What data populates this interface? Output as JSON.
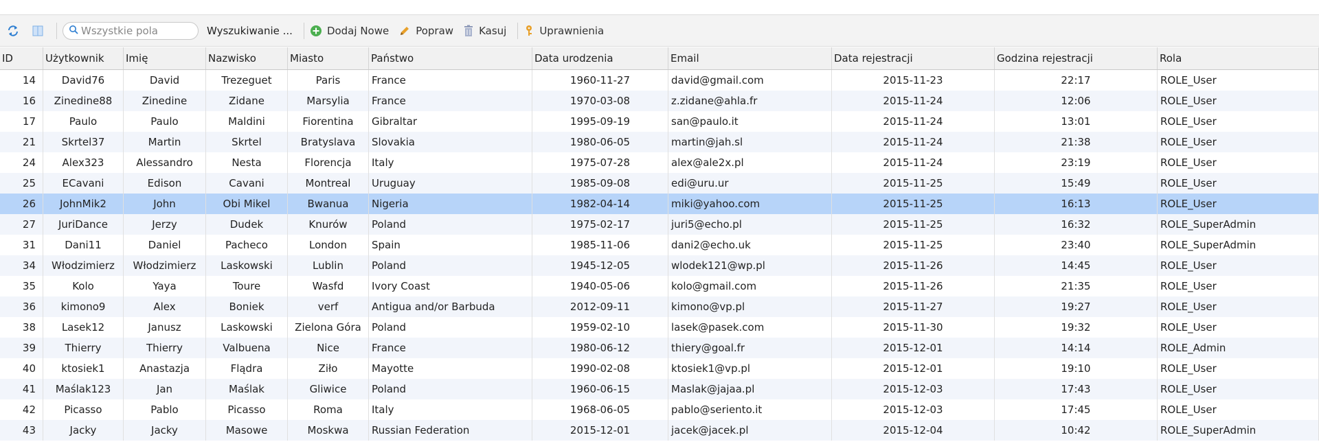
{
  "toolbar": {
    "search_placeholder": "Wszystkie pola",
    "advanced_search": "Wyszukiwanie ...",
    "add_new": "Dodaj Nowe",
    "edit": "Popraw",
    "delete": "Kasuj",
    "permissions": "Uprawnienia"
  },
  "colors": {
    "selected_row": "#b7d4f9",
    "alt_row": "#f2f5fb",
    "add_icon": "#4caf50",
    "edit_icon": "#e8a02a",
    "delete_icon": "#8e9ab8",
    "permissions_icon": "#e8a02a"
  },
  "table": {
    "columns": [
      "ID",
      "Użytkownik",
      "Imię",
      "Nazwisko",
      "Miasto",
      "Państwo",
      "Data urodzenia",
      "Email",
      "Data rejestracji",
      "Godzina rejestracji",
      "Rola"
    ],
    "selected_id": "26",
    "rows": [
      [
        "14",
        "David76",
        "David",
        "Trezeguet",
        "Paris",
        "France",
        "1960-11-27",
        "david@gmail.com",
        "2015-11-23",
        "22:17",
        "ROLE_User"
      ],
      [
        "16",
        "Zinedine88",
        "Zinedine",
        "Zidane",
        "Marsylia",
        "France",
        "1970-03-08",
        "z.zidane@ahla.fr",
        "2015-11-24",
        "12:06",
        "ROLE_User"
      ],
      [
        "17",
        "Paulo",
        "Paulo",
        "Maldini",
        "Fiorentina",
        "Gibraltar",
        "1995-09-19",
        "san@paulo.it",
        "2015-11-24",
        "13:01",
        "ROLE_User"
      ],
      [
        "21",
        "Skrtel37",
        "Martin",
        "Skrtel",
        "Bratyslava",
        "Slovakia",
        "1980-06-05",
        "martin@jah.sl",
        "2015-11-24",
        "21:38",
        "ROLE_User"
      ],
      [
        "24",
        "Alex323",
        "Alessandro",
        "Nesta",
        "Florencja",
        "Italy",
        "1975-07-28",
        "alex@ale2x.pl",
        "2015-11-24",
        "23:19",
        "ROLE_User"
      ],
      [
        "25",
        "ECavani",
        "Edison",
        "Cavani",
        "Montreal",
        "Uruguay",
        "1985-09-08",
        "edi@uru.ur",
        "2015-11-25",
        "15:49",
        "ROLE_User"
      ],
      [
        "26",
        "JohnMik2",
        "John",
        "Obi Mikel",
        "Bwanua",
        "Nigeria",
        "1982-04-14",
        "miki@yahoo.com",
        "2015-11-25",
        "16:13",
        "ROLE_User"
      ],
      [
        "27",
        "JuriDance",
        "Jerzy",
        "Dudek",
        "Knurów",
        "Poland",
        "1975-02-17",
        "juri5@echo.pl",
        "2015-11-25",
        "16:32",
        "ROLE_SuperAdmin"
      ],
      [
        "31",
        "Dani11",
        "Daniel",
        "Pacheco",
        "London",
        "Spain",
        "1985-11-06",
        "dani2@echo.uk",
        "2015-11-25",
        "23:40",
        "ROLE_SuperAdmin"
      ],
      [
        "34",
        "Włodzimierz",
        "Włodzimierz",
        "Laskowski",
        "Lublin",
        "Poland",
        "1945-12-05",
        "wlodek121@wp.pl",
        "2015-11-26",
        "14:45",
        "ROLE_User"
      ],
      [
        "35",
        "Kolo",
        "Yaya",
        "Toure",
        "Wasfd",
        "Ivory Coast",
        "1940-05-06",
        "kolo@gmail.com",
        "2015-11-26",
        "21:35",
        "ROLE_User"
      ],
      [
        "36",
        "kimono9",
        "Alex",
        "Boniek",
        "verf",
        "Antigua and/or Barbuda",
        "2012-09-11",
        "kimono@vp.pl",
        "2015-11-27",
        "19:27",
        "ROLE_User"
      ],
      [
        "38",
        "Lasek12",
        "Janusz",
        "Laskowski",
        "Zielona Góra",
        "Poland",
        "1959-02-10",
        "lasek@pasek.com",
        "2015-11-30",
        "19:32",
        "ROLE_User"
      ],
      [
        "39",
        "Thierry",
        "Thierry",
        "Valbuena",
        "Nice",
        "France",
        "1980-06-12",
        "thiery@goal.fr",
        "2015-12-01",
        "14:14",
        "ROLE_Admin"
      ],
      [
        "40",
        "ktosiek1",
        "Anastazja",
        "Flądra",
        "Ziło",
        "Mayotte",
        "1990-02-08",
        "ktosiek1@vp.pl",
        "2015-12-01",
        "19:10",
        "ROLE_User"
      ],
      [
        "41",
        "Maślak123",
        "Jan",
        "Maślak",
        "Gliwice",
        "Poland",
        "1960-06-15",
        "Maslak@jajaa.pl",
        "2015-12-03",
        "17:43",
        "ROLE_User"
      ],
      [
        "42",
        "Picasso",
        "Pablo",
        "Picasso",
        "Roma",
        "Italy",
        "1968-06-05",
        "pablo@seriento.it",
        "2015-12-03",
        "17:45",
        "ROLE_User"
      ],
      [
        "43",
        "Jacky",
        "Jacky",
        "Masowe",
        "Moskwa",
        "Russian Federation",
        "2015-12-01",
        "jacek@jacek.pl",
        "2015-12-04",
        "10:42",
        "ROLE_SuperAdmin"
      ]
    ]
  }
}
